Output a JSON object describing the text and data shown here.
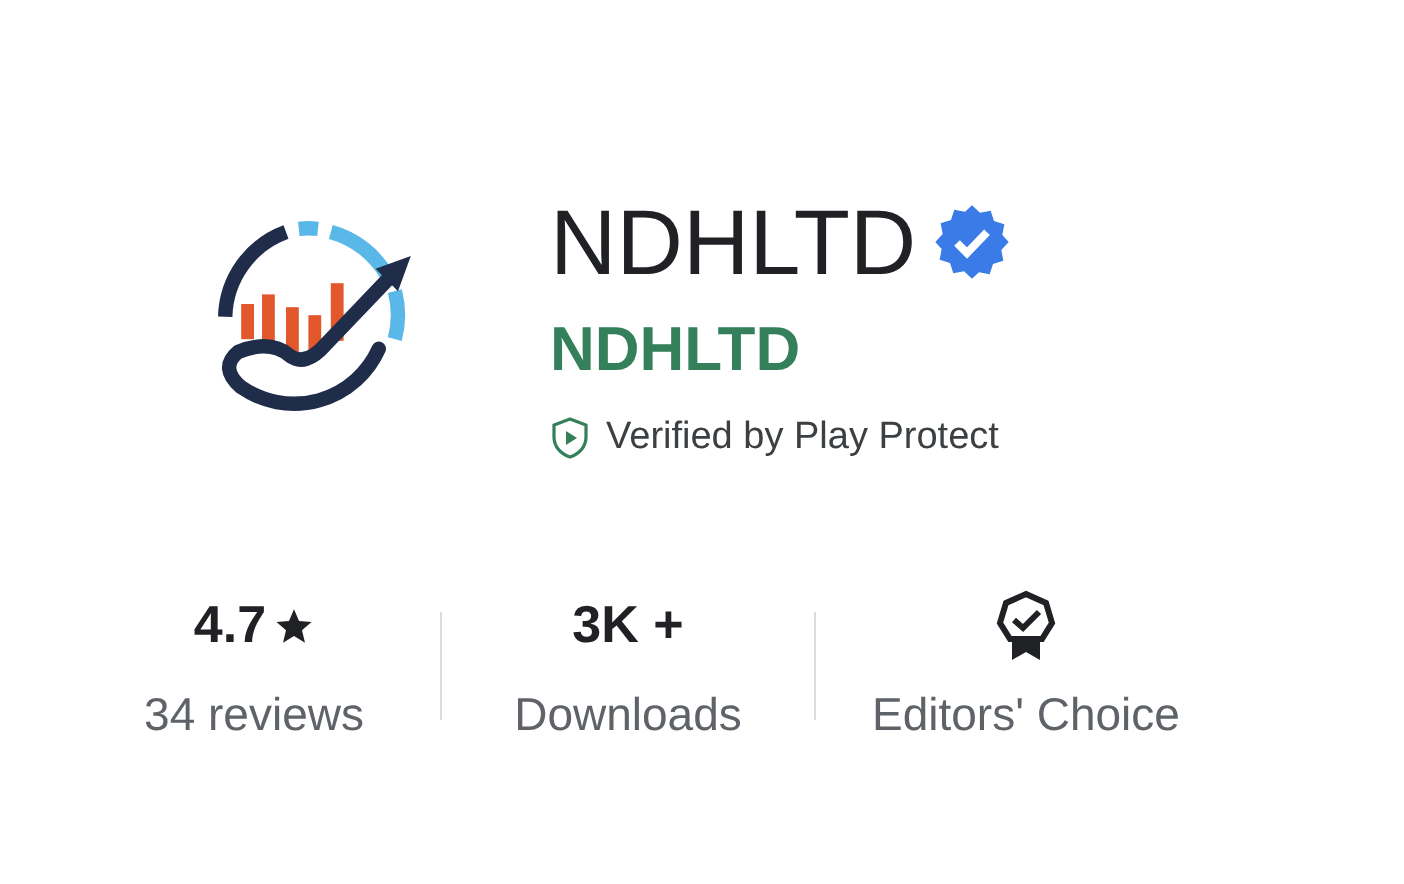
{
  "app": {
    "name": "NDHLTD",
    "verified": true,
    "developer": "NDHLTD",
    "protection": "Verified by Play Protect"
  },
  "stats": [
    {
      "kind": "rating",
      "value": "4.7",
      "label": "34 reviews"
    },
    {
      "kind": "text",
      "value": "3K +",
      "label": "Downloads"
    },
    {
      "kind": "badge",
      "label": "Editors' Choice"
    }
  ]
}
